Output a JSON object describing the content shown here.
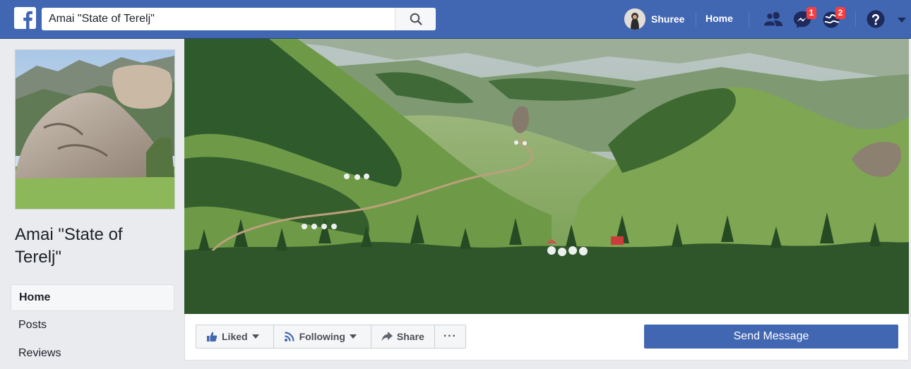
{
  "topbar": {
    "search_value": "Amai \"State of Terelj\"",
    "profile_name": "Shuree",
    "home_label": "Home",
    "messages_badge": "1",
    "notifications_badge": "2",
    "bg_color": "#4267b2",
    "icons": [
      "facebook-logo-icon",
      "search-icon",
      "friend-requests-icon",
      "messenger-icon",
      "notifications-icon",
      "help-icon",
      "dropdown-caret-icon"
    ]
  },
  "page": {
    "name": "Amai \"State of Terelj\""
  },
  "sidebar": {
    "items": [
      {
        "label": "Home",
        "active": true
      },
      {
        "label": "Posts",
        "active": false
      },
      {
        "label": "Reviews",
        "active": false
      }
    ]
  },
  "actions": {
    "liked_label": "Liked",
    "following_label": "Following",
    "share_label": "Share",
    "more_label": "···",
    "send_message_label": "Send Message",
    "accent_color": "#4267b2"
  }
}
